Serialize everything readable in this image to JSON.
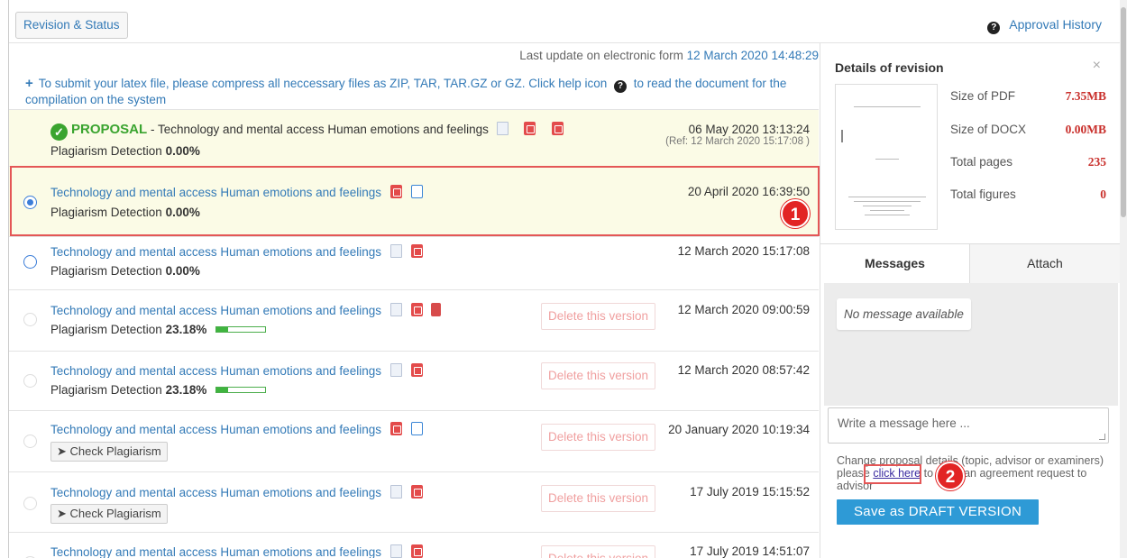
{
  "toolbar": {
    "revision_status_label": "Revision & Status",
    "approval_history_label": "Approval History"
  },
  "main": {
    "last_update_prefix": "Last update on electronic form",
    "last_update_date": "12 March 2020 14:48:29",
    "notice_text": "To submit your latex file, please compress all neccessary files as ZIP, TAR, TAR.GZ or GZ. Click help icon",
    "notice_suffix": "to read the document for the compilation on the system"
  },
  "proposal_row": {
    "label": "PROPOSAL",
    "title": "- Technology and mental access Human emotions and feelings",
    "plagiarism_label": "Plagiarism Detection",
    "plagiarism_value": "0.00%",
    "date": "06 May 2020 13:13:24",
    "ref": "(Ref: 12 March 2020 15:17:08 )"
  },
  "rows": [
    {
      "title": "Technology and mental access Human emotions and feelings",
      "plagiarism_label": "Plagiarism Detection",
      "plagiarism_value": "0.00%",
      "date": "20 April 2020 16:39:50"
    },
    {
      "title": "Technology and mental access Human emotions and feelings",
      "plagiarism_label": "Plagiarism Detection",
      "plagiarism_value": "0.00%",
      "date": "12 March 2020 15:17:08"
    },
    {
      "title": "Technology and mental access Human emotions and feelings",
      "plagiarism_label": "Plagiarism Detection",
      "plagiarism_value": "23.18%",
      "plagiarism_fraction": 0.23,
      "date": "12 March 2020 09:00:59",
      "delete_label": "Delete this version"
    },
    {
      "title": "Technology and mental access Human emotions and feelings",
      "plagiarism_label": "Plagiarism Detection",
      "plagiarism_value": "23.18%",
      "plagiarism_fraction": 0.23,
      "date": "12 March 2020 08:57:42",
      "delete_label": "Delete this version"
    },
    {
      "title": "Technology and mental access Human emotions and feelings",
      "check_label": "Check Plagiarism",
      "date": "20 January 2020 10:19:34",
      "delete_label": "Delete this version"
    },
    {
      "title": "Technology and mental access Human emotions and feelings",
      "check_label": "Check Plagiarism",
      "date": "17 July 2019 15:15:52",
      "delete_label": "Delete this version"
    },
    {
      "title": "Technology and mental access Human emotions and feelings",
      "date": "17 July 2019 14:51:07",
      "delete_label": "Delete this version"
    }
  ],
  "badges": {
    "one": "1",
    "two": "2"
  },
  "side": {
    "title": "Details of revision",
    "close": "×",
    "stats": [
      {
        "label": "Size of PDF",
        "value": "7.35MB"
      },
      {
        "label": "Size of DOCX",
        "value": "0.00MB"
      },
      {
        "label": "Total pages",
        "value": "235"
      },
      {
        "label": "Total figures",
        "value": "0"
      }
    ],
    "tabs": {
      "messages": "Messages",
      "attach": "Attach"
    },
    "no_message": "No message available",
    "message_placeholder": "Write a message here ...",
    "change_text_before": "Change proposal details (topic, advisor or examiners) please",
    "change_link": "click here",
    "change_text_after": "to send an agreement request to advisor",
    "draft_button": "Save as DRAFT VERSION"
  },
  "colors": {
    "accent": "#337ab7",
    "success": "#3aa42f",
    "danger": "#c9302c",
    "highlight": "#e45656",
    "draft_button": "#2e9ad6"
  },
  "icons": [
    "question-circle-icon",
    "plus-icon",
    "check-circle-icon",
    "docx-file-icon",
    "pdf-file-icon",
    "code-file-icon",
    "flag-file-icon",
    "send-icon",
    "close-icon"
  ]
}
